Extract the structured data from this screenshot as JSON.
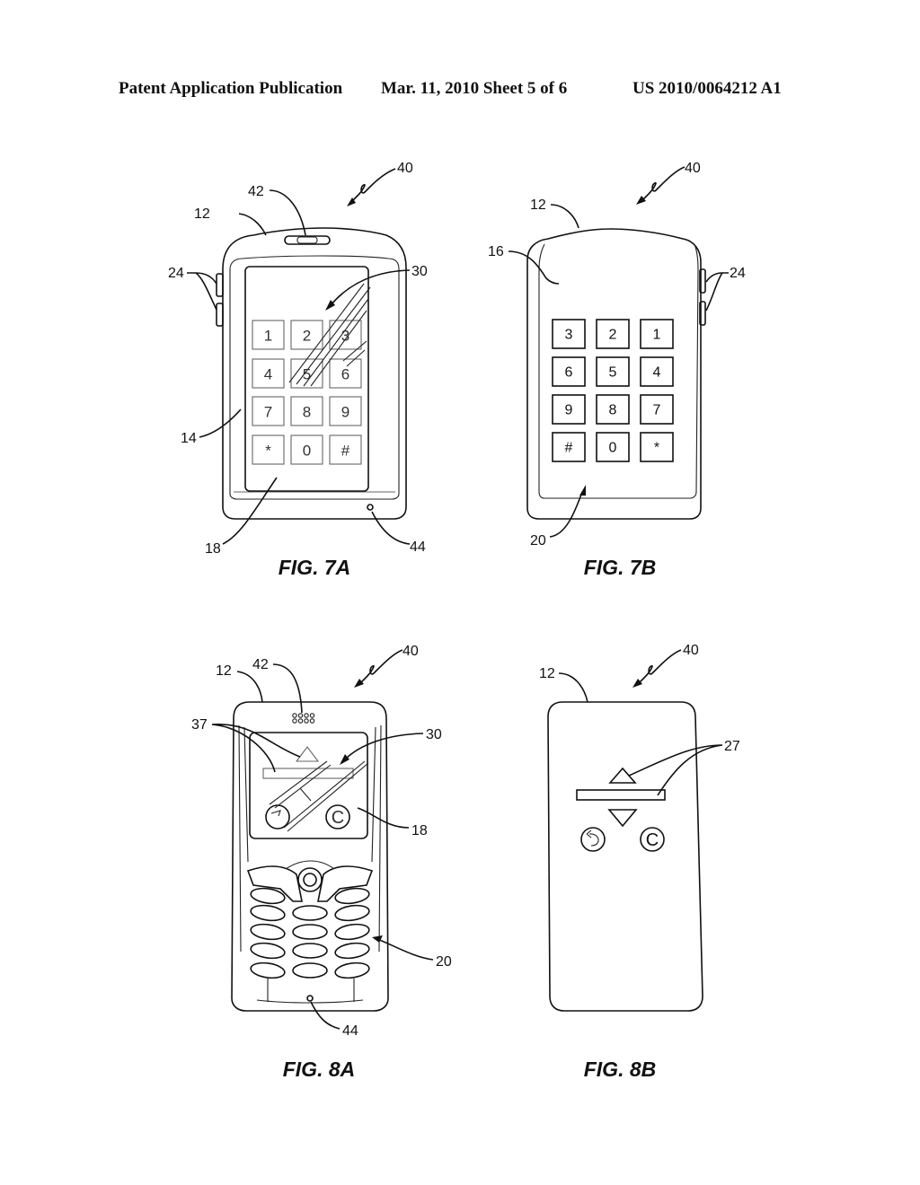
{
  "header": {
    "publication": "Patent Application Publication",
    "date_sheet": "Mar. 11, 2010  Sheet 5 of 6",
    "pub_number": "US 2010/0064212 A1"
  },
  "figures": {
    "fig7a": {
      "caption": "FIG. 7A",
      "refs": {
        "device": "40",
        "housing": "12",
        "speaker": "42",
        "side_buttons": "24",
        "touch": "30",
        "bezel": "14",
        "screen": "18",
        "microphone": "44"
      },
      "keys": [
        "1",
        "2",
        "3",
        "4",
        "5",
        "6",
        "7",
        "8",
        "9",
        "*",
        "0",
        "#"
      ]
    },
    "fig7b": {
      "caption": "FIG. 7B",
      "refs": {
        "device": "40",
        "housing": "12",
        "back_surface": "16",
        "side_buttons": "24",
        "keypad": "20"
      },
      "keys": [
        "3",
        "2",
        "1",
        "6",
        "5",
        "4",
        "9",
        "8",
        "7",
        "#",
        "0",
        "*"
      ]
    },
    "fig8a": {
      "caption": "FIG. 8A",
      "refs": {
        "device": "40",
        "housing": "12",
        "speaker": "42",
        "controls": "37",
        "touch": "30",
        "screen": "18",
        "keypad": "20",
        "microphone": "44"
      },
      "screen_icons": [
        "up-triangle-icon",
        "slider-bar",
        "back-arrow-icon",
        "clear-c-icon"
      ],
      "clear_glyph": "C"
    },
    "fig8b": {
      "caption": "FIG. 8B",
      "refs": {
        "device": "40",
        "housing": "12",
        "rear_controls": "27"
      },
      "clear_glyph": "C"
    }
  }
}
